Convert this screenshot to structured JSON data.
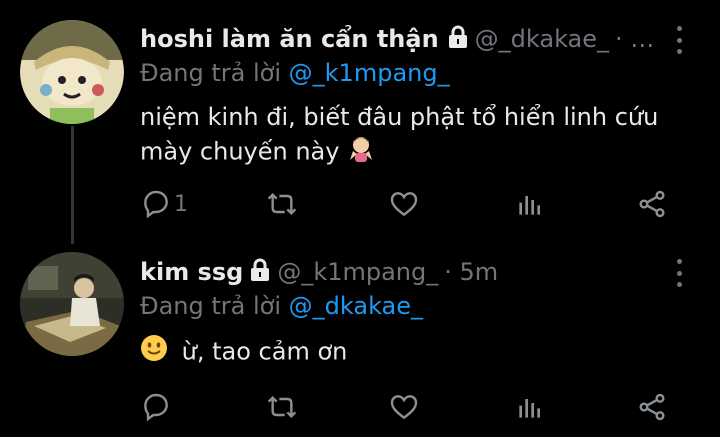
{
  "tweets": [
    {
      "name": "hoshi làm ăn cẩn thận",
      "handle": "@_dkakae_",
      "time_sep": "· …",
      "reply_prefix": "Đang trả lời",
      "reply_to": "@_k1mpang_",
      "text": "niệm kinh đi, biết đâu phật tổ hiển linh cứu mày chuyến này",
      "emoji": "person-shrugging-emoji",
      "reply_count": "1"
    },
    {
      "name": "kim ssg",
      "handle": "@_k1mpang_",
      "time_sep": "· 5m",
      "reply_prefix": "Đang trả lời",
      "reply_to": "@_dkakae_",
      "emoji": "slightly-smiling-face-emoji",
      "text": "ừ, tao cảm ơn",
      "reply_count": ""
    }
  ],
  "colors": {
    "accent": "#1d9bf0",
    "muted": "#71767b",
    "text": "#e7e9ea",
    "background": "#000000"
  }
}
